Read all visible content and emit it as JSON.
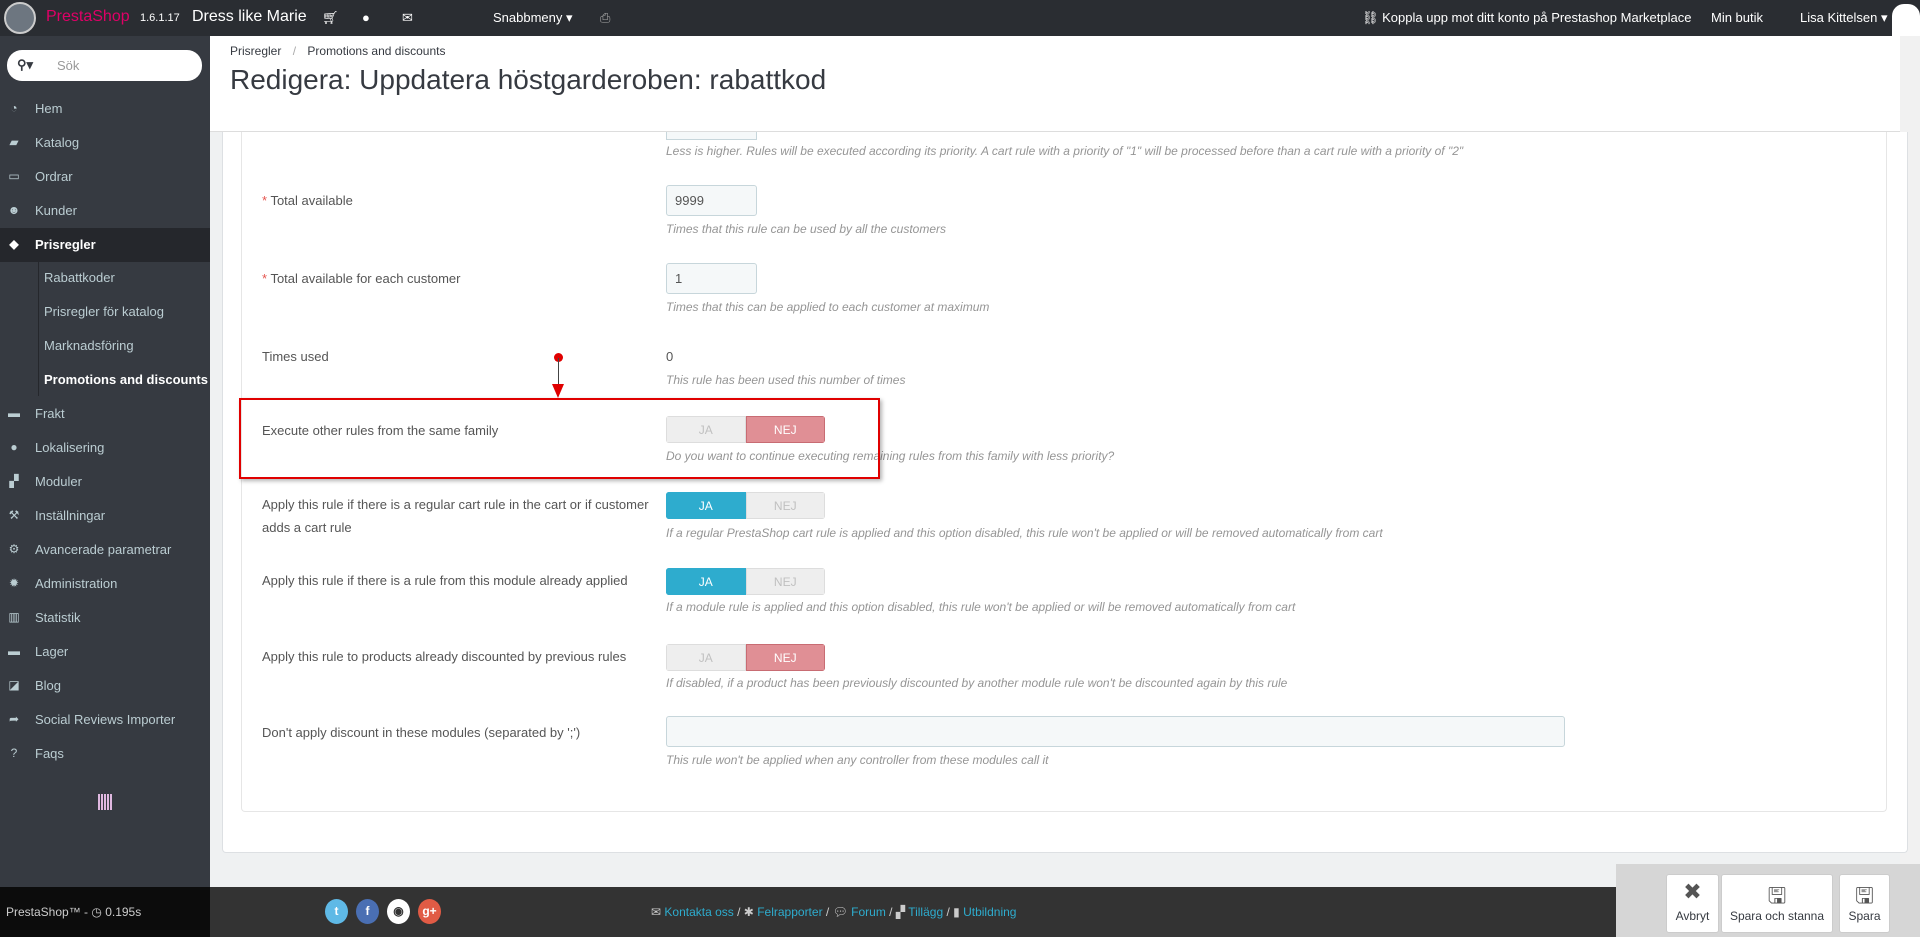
{
  "topbar": {
    "brand": "PrestaShop",
    "version": "1.6.1.17",
    "shop_name": "Dress like Marie",
    "quick_menu": "Snabbmeny",
    "marketplace": "Koppla upp mot ditt konto på Prestashop Marketplace",
    "my_shop": "Min butik",
    "user": "Lisa Kittelsen"
  },
  "sidebar": {
    "search_placeholder": "Sök",
    "items": [
      {
        "label": "Hem",
        "icon": "dashboard-icon"
      },
      {
        "label": "Katalog",
        "icon": "book-icon"
      },
      {
        "label": "Ordrar",
        "icon": "credit-card-icon"
      },
      {
        "label": "Kunder",
        "icon": "users-icon"
      },
      {
        "label": "Prisregler",
        "icon": "tags-icon"
      }
    ],
    "sub": [
      "Rabattkoder",
      "Prisregler för katalog",
      "Marknadsföring",
      "Promotions and discounts"
    ],
    "items2": [
      {
        "label": "Frakt",
        "icon": "truck-icon"
      },
      {
        "label": "Lokalisering",
        "icon": "globe-icon"
      },
      {
        "label": "Moduler",
        "icon": "puzzle-icon"
      },
      {
        "label": "Inställningar",
        "icon": "wrench-icon"
      },
      {
        "label": "Avancerade parametrar",
        "icon": "cogs-icon"
      },
      {
        "label": "Administration",
        "icon": "cog-icon"
      },
      {
        "label": "Statistik",
        "icon": "bar-chart-icon"
      },
      {
        "label": "Lager",
        "icon": "archive-icon"
      },
      {
        "label": "Blog",
        "icon": "edit-icon"
      },
      {
        "label": "Social Reviews Importer",
        "icon": "share-icon"
      },
      {
        "label": "Faqs",
        "icon": "question-icon"
      }
    ]
  },
  "header": {
    "breadcrumb": [
      "Prisregler",
      "Promotions and discounts"
    ],
    "title": "Redigera: Uppdatera höstgarderoben: rabattkod"
  },
  "form": {
    "priority_help": "Less is higher. Rules will be executed according its priority. A cart rule with a priority of \"1\" will be processed before than a cart rule with a priority of \"2\"",
    "total_available": {
      "label": "Total available",
      "value": "9999",
      "help": "Times that this rule can be used by all the customers"
    },
    "total_per_customer": {
      "label": "Total available for each customer",
      "value": "1",
      "help": "Times that this can be applied to each customer at maximum"
    },
    "times_used": {
      "label": "Times used",
      "value": "0",
      "help": "This rule has been used this number of times"
    },
    "yes": "JA",
    "no": "NEJ",
    "toggles": [
      {
        "label": "Execute other rules from the same family",
        "value": "NEJ",
        "help": "Do you want to continue executing remaining rules from this family with less priority?"
      },
      {
        "label": "Apply this rule if there is a regular cart rule in the cart or if customer adds a cart rule",
        "value": "JA",
        "help": "If a regular PrestaShop cart rule is applied and this option disabled, this rule won't be applied or will be removed automatically from cart"
      },
      {
        "label": "Apply this rule if there is a rule from this module already applied",
        "value": "JA",
        "help": "If a module rule is applied and this option disabled, this rule won't be applied or will be removed automatically from cart"
      },
      {
        "label": "Apply this rule to products already discounted by previous rules",
        "value": "NEJ",
        "help": "If disabled, if a product has been previously discounted by another module rule won't be discounted again by this rule"
      }
    ],
    "exclude_modules": {
      "label": "Don't apply discount in these modules (separated by ';')",
      "value": "",
      "help": "This rule won't be applied when any controller from these modules call it"
    }
  },
  "footer": {
    "version": "PrestaShop™ - ",
    "time": "0.195s",
    "links": [
      "Kontakta oss",
      "Felrapporter",
      "Forum",
      "Tillägg",
      "Utbildning"
    ],
    "social": [
      "twitter",
      "facebook",
      "github",
      "google-plus"
    ]
  },
  "actions": {
    "cancel": "Avbryt",
    "save_stay": "Spara och stanna",
    "save": "Spara"
  },
  "colors": {
    "accent": "#2eacce",
    "no": "#e08f95",
    "annotation": "#e00000"
  }
}
